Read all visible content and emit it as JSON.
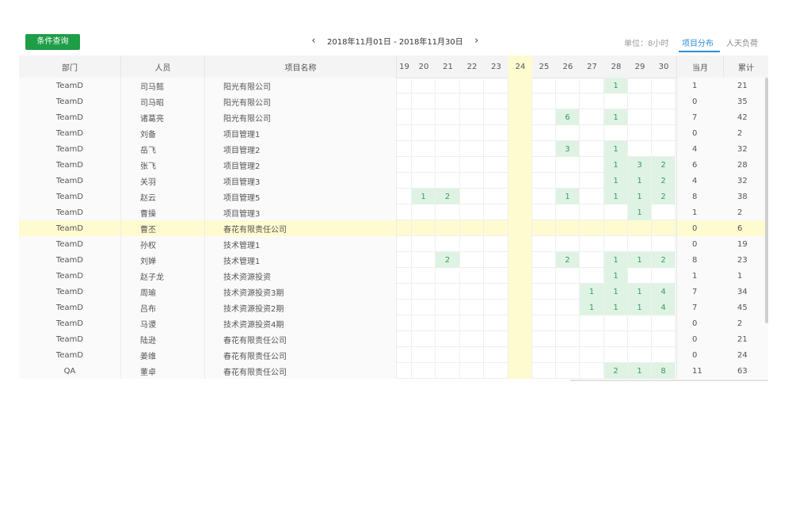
{
  "toolbar": {
    "query_button": "条件查询"
  },
  "date_range": {
    "prev": "‹",
    "label": "2018年11月01日 - 2018年11月30日",
    "next": "›"
  },
  "view": {
    "unit": "单位：8小时",
    "tabs": [
      {
        "label": "项目分布"
      },
      {
        "label": "人天负荷"
      }
    ]
  },
  "table": {
    "headers": {
      "dept": "部门",
      "person": "人员",
      "project": "项目名称",
      "month": "当月",
      "total": "累计"
    },
    "days": [
      "19",
      "20",
      "21",
      "22",
      "23",
      "24",
      "25",
      "26",
      "27",
      "28",
      "29",
      "30"
    ],
    "today": "24",
    "rows": [
      {
        "dept": "TeamD",
        "person": "司马懿",
        "project": "阳光有限公司",
        "cells": [
          "",
          "",
          "",
          "",
          "",
          "",
          "",
          "",
          "",
          "1",
          "",
          ""
        ],
        "month": "1",
        "total": "21"
      },
      {
        "dept": "TeamD",
        "person": "司马昭",
        "project": "阳光有限公司",
        "cells": [
          "",
          "",
          "",
          "",
          "",
          "",
          "",
          "",
          "",
          "",
          "",
          ""
        ],
        "month": "0",
        "total": "35"
      },
      {
        "dept": "TeamD",
        "person": "诸葛亮",
        "project": "阳光有限公司",
        "cells": [
          "",
          "",
          "",
          "",
          "",
          "",
          "",
          "6",
          "",
          "1",
          "",
          ""
        ],
        "month": "7",
        "total": "42"
      },
      {
        "dept": "TeamD",
        "person": "刘备",
        "project": "项目管理1",
        "cells": [
          "",
          "",
          "",
          "",
          "",
          "",
          "",
          "",
          "",
          "",
          "",
          ""
        ],
        "month": "0",
        "total": "2"
      },
      {
        "dept": "TeamD",
        "person": "岳飞",
        "project": "项目管理2",
        "cells": [
          "",
          "",
          "",
          "",
          "",
          "",
          "",
          "3",
          "",
          "1",
          "",
          ""
        ],
        "month": "4",
        "total": "32"
      },
      {
        "dept": "TeamD",
        "person": "张飞",
        "project": "项目管理2",
        "cells": [
          "",
          "",
          "",
          "",
          "",
          "",
          "",
          "",
          "",
          "1",
          "3",
          "2"
        ],
        "month": "6",
        "total": "28"
      },
      {
        "dept": "TeamD",
        "person": "关羽",
        "project": "项目管理3",
        "cells": [
          "",
          "",
          "",
          "",
          "",
          "",
          "",
          "",
          "",
          "1",
          "1",
          "2"
        ],
        "month": "4",
        "total": "32"
      },
      {
        "dept": "TeamD",
        "person": "赵云",
        "project": "项目管理5",
        "cells": [
          "",
          "1",
          "2",
          "",
          "",
          "",
          "",
          "1",
          "",
          "1",
          "1",
          "2"
        ],
        "month": "8",
        "total": "38"
      },
      {
        "dept": "TeamD",
        "person": "曹操",
        "project": "项目管理3",
        "cells": [
          "",
          "",
          "",
          "",
          "",
          "",
          "",
          "",
          "",
          "",
          "1",
          ""
        ],
        "month": "1",
        "total": "2"
      },
      {
        "dept": "TeamD",
        "person": "曹丕",
        "project": "春花有限责任公司",
        "cells": [
          "",
          "",
          "",
          "",
          "",
          "",
          "",
          "",
          "",
          "",
          "",
          ""
        ],
        "month": "0",
        "total": "6",
        "highlight": true
      },
      {
        "dept": "TeamD",
        "person": "孙权",
        "project": "技术管理1",
        "cells": [
          "",
          "",
          "",
          "",
          "",
          "",
          "",
          "",
          "",
          "",
          "",
          ""
        ],
        "month": "0",
        "total": "19"
      },
      {
        "dept": "TeamD",
        "person": "刘婵",
        "project": "技术管理1",
        "cells": [
          "",
          "",
          "2",
          "",
          "",
          "",
          "",
          "2",
          "",
          "1",
          "1",
          "2"
        ],
        "month": "8",
        "total": "23"
      },
      {
        "dept": "TeamD",
        "person": "赵子龙",
        "project": "技术资源投资",
        "cells": [
          "",
          "",
          "",
          "",
          "",
          "",
          "",
          "",
          "",
          "1",
          "",
          ""
        ],
        "month": "1",
        "total": "1"
      },
      {
        "dept": "TeamD",
        "person": "周瑜",
        "project": "技术资源投资3期",
        "cells": [
          "",
          "",
          "",
          "",
          "",
          "",
          "",
          "",
          "1",
          "1",
          "1",
          "4"
        ],
        "month": "7",
        "total": "34"
      },
      {
        "dept": "TeamD",
        "person": "吕布",
        "project": "技术资源投资2期",
        "cells": [
          "",
          "",
          "",
          "",
          "",
          "",
          "",
          "",
          "1",
          "1",
          "1",
          "4"
        ],
        "month": "7",
        "total": "45"
      },
      {
        "dept": "TeamD",
        "person": "马谡",
        "project": "技术资源投资4期",
        "cells": [
          "",
          "",
          "",
          "",
          "",
          "",
          "",
          "",
          "",
          "",
          "",
          ""
        ],
        "month": "0",
        "total": "2"
      },
      {
        "dept": "TeamD",
        "person": "陆逊",
        "project": "春花有限责任公司",
        "cells": [
          "",
          "",
          "",
          "",
          "",
          "",
          "",
          "",
          "",
          "",
          "",
          ""
        ],
        "month": "0",
        "total": "21"
      },
      {
        "dept": "TeamD",
        "person": "姜维",
        "project": "春花有限责任公司",
        "cells": [
          "",
          "",
          "",
          "",
          "",
          "",
          "",
          "",
          "",
          "",
          "",
          ""
        ],
        "month": "0",
        "total": "24"
      },
      {
        "dept": "QA",
        "person": "董卓",
        "project": "春花有限责任公司",
        "cells": [
          "",
          "",
          "",
          "",
          "",
          "",
          "",
          "",
          "",
          "2",
          "1",
          "8"
        ],
        "month": "11",
        "total": "63"
      }
    ]
  }
}
